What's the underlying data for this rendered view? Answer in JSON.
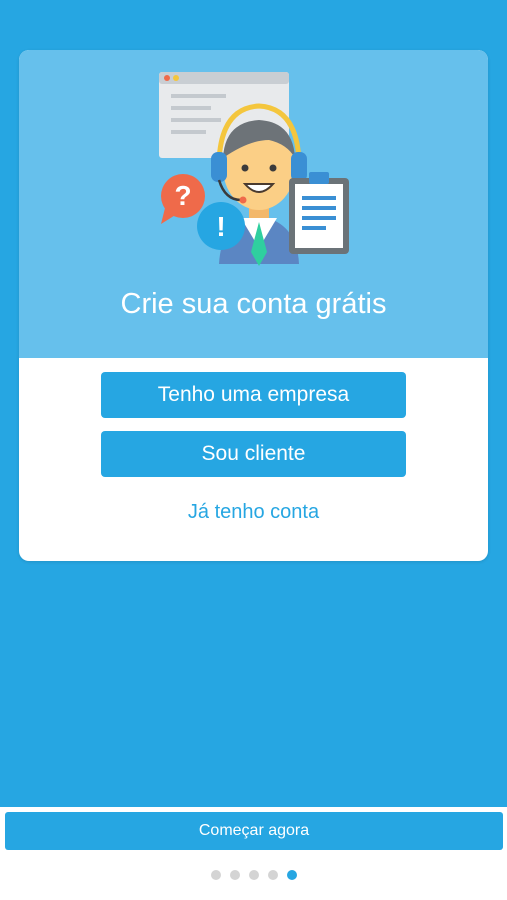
{
  "card": {
    "title": "Crie sua conta grátis",
    "buttons": {
      "company": "Tenho uma empresa",
      "client": "Sou cliente"
    },
    "link": "Já tenho conta"
  },
  "footer": {
    "start_label": "Começar agora"
  },
  "pager": {
    "total": 5,
    "active_index": 4
  },
  "colors": {
    "primary": "#26a6e2",
    "card_header": "#66c0ec",
    "dot_inactive": "#d4d4d4"
  },
  "illustration": {
    "icons": [
      "browser-window-icon",
      "support-agent-headset-icon",
      "question-bubble-icon",
      "exclamation-bubble-icon",
      "clipboard-icon"
    ]
  }
}
